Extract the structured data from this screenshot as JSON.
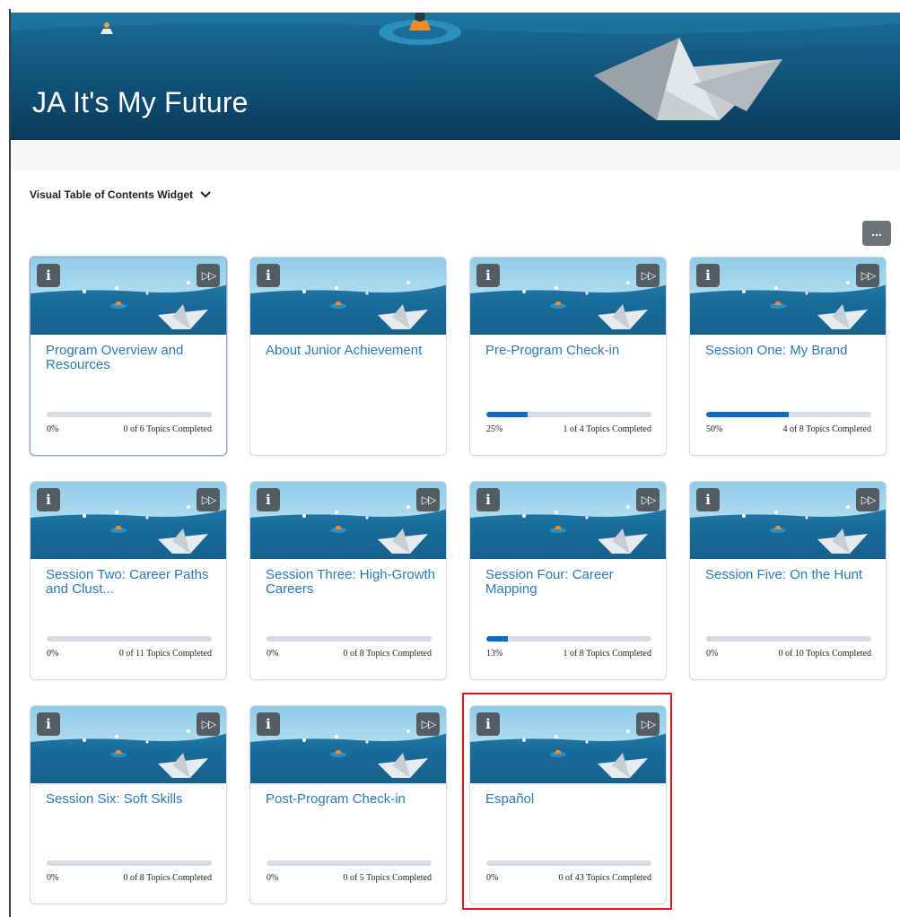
{
  "banner": {
    "title": "JA It's My Future"
  },
  "widget": {
    "title": "Visual Table of Contents Widget",
    "more_label": "..."
  },
  "card_buttons": {
    "info_label": "i",
    "skip_label": "▷▷"
  },
  "cards": [
    {
      "title": "Program Overview and Resources",
      "percent": "0%",
      "progress": 0,
      "completed": "0 of 6 Topics Completed",
      "has_skip": true,
      "has_progress": true
    },
    {
      "title": "About Junior Achievement",
      "percent": "",
      "progress": 0,
      "completed": "",
      "has_skip": false,
      "has_progress": false
    },
    {
      "title": "Pre-Program Check-in",
      "percent": "25%",
      "progress": 0.25,
      "completed": "1 of 4 Topics Completed",
      "has_skip": true,
      "has_progress": true
    },
    {
      "title": "Session One: My Brand",
      "percent": "50%",
      "progress": 0.5,
      "completed": "4 of 8 Topics Completed",
      "has_skip": true,
      "has_progress": true
    },
    {
      "title": "Session Two: Career Paths and Clust...",
      "percent": "0%",
      "progress": 0,
      "completed": "0 of 11 Topics Completed",
      "has_skip": true,
      "has_progress": true
    },
    {
      "title": "Session Three: High-Growth Careers",
      "percent": "0%",
      "progress": 0,
      "completed": "0 of 8 Topics Completed",
      "has_skip": true,
      "has_progress": true
    },
    {
      "title": "Session Four: Career Mapping",
      "percent": "13%",
      "progress": 0.13,
      "completed": "1 of 8 Topics Completed",
      "has_skip": true,
      "has_progress": true
    },
    {
      "title": "Session Five: On the Hunt",
      "percent": "0%",
      "progress": 0,
      "completed": "0 of 10 Topics Completed",
      "has_skip": true,
      "has_progress": true
    },
    {
      "title": "Session Six: Soft Skills",
      "percent": "0%",
      "progress": 0,
      "completed": "0 of 8 Topics Completed",
      "has_skip": true,
      "has_progress": true
    },
    {
      "title": "Post-Program Check-in",
      "percent": "0%",
      "progress": 0,
      "completed": "0 of 5 Topics Completed",
      "has_skip": true,
      "has_progress": true
    },
    {
      "title": "Español",
      "percent": "0%",
      "progress": 0,
      "completed": "0 of 43 Topics Completed",
      "has_skip": true,
      "has_progress": true
    }
  ],
  "colors": {
    "link": "#2a7ab8",
    "progress": "#0b6cbf",
    "highlight": "#e0141b",
    "banner": "#0d5179"
  }
}
